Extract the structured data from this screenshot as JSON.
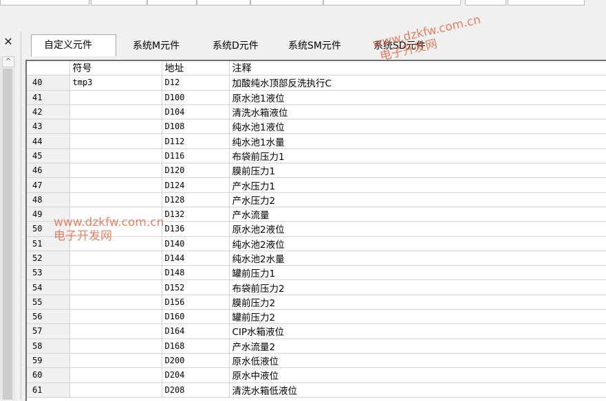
{
  "dock": {
    "close_icon": "close-icon",
    "scroll_up_icon": "chevron-up-icon"
  },
  "tabs": [
    {
      "label": "自定义元件"
    },
    {
      "label": "系统M元件"
    },
    {
      "label": "系统D元件"
    },
    {
      "label": "系统SM元件"
    },
    {
      "label": "系统SD元件"
    }
  ],
  "table": {
    "headers": {
      "index": "",
      "symbol": "符号",
      "address": "地址",
      "comment": "注释"
    },
    "rows": [
      {
        "index": "40",
        "symbol": "tmp3",
        "address": "D12",
        "comment": "加酸纯水顶部反洗执行C"
      },
      {
        "index": "41",
        "symbol": "",
        "address": "D100",
        "comment": "原水池1液位"
      },
      {
        "index": "42",
        "symbol": "",
        "address": "D104",
        "comment": "清洗水箱液位"
      },
      {
        "index": "43",
        "symbol": "",
        "address": "D108",
        "comment": "纯水池1液位"
      },
      {
        "index": "44",
        "symbol": "",
        "address": "D112",
        "comment": "纯水池1水量"
      },
      {
        "index": "45",
        "symbol": "",
        "address": "D116",
        "comment": "布袋前压力1"
      },
      {
        "index": "46",
        "symbol": "",
        "address": "D120",
        "comment": "膜前压力1"
      },
      {
        "index": "47",
        "symbol": "",
        "address": "D124",
        "comment": "产水压力1"
      },
      {
        "index": "48",
        "symbol": "",
        "address": "D128",
        "comment": "产水压力2"
      },
      {
        "index": "49",
        "symbol": "",
        "address": "D132",
        "comment": "产水流量"
      },
      {
        "index": "50",
        "symbol": "",
        "address": "D136",
        "comment": "原水池2液位"
      },
      {
        "index": "51",
        "symbol": "",
        "address": "D140",
        "comment": "纯水池2液位"
      },
      {
        "index": "52",
        "symbol": "",
        "address": "D144",
        "comment": "纯水池2水量"
      },
      {
        "index": "53",
        "symbol": "",
        "address": "D148",
        "comment": "罐前压力1"
      },
      {
        "index": "54",
        "symbol": "",
        "address": "D152",
        "comment": "布袋前压力2"
      },
      {
        "index": "55",
        "symbol": "",
        "address": "D156",
        "comment": "膜前压力2"
      },
      {
        "index": "56",
        "symbol": "",
        "address": "D160",
        "comment": "罐前压力2"
      },
      {
        "index": "57",
        "symbol": "",
        "address": "D164",
        "comment": "CIP水箱液位"
      },
      {
        "index": "58",
        "symbol": "",
        "address": "D168",
        "comment": "产水流量2"
      },
      {
        "index": "59",
        "symbol": "",
        "address": "D200",
        "comment": "原水低液位"
      },
      {
        "index": "60",
        "symbol": "",
        "address": "D204",
        "comment": "原水中液位"
      },
      {
        "index": "61",
        "symbol": "",
        "address": "D208",
        "comment": "清洗水箱低液位"
      }
    ]
  },
  "watermarks": [
    {
      "line1": "www.dzkfw.com.cn",
      "line2": "电子开发网"
    },
    {
      "line1": "www.dzkfw.com.cn",
      "line2": "电子开发网"
    }
  ],
  "colors": {
    "watermark": "#e2603a",
    "grid_line": "#d4d4d4",
    "row_header": "#f0f0f0"
  }
}
